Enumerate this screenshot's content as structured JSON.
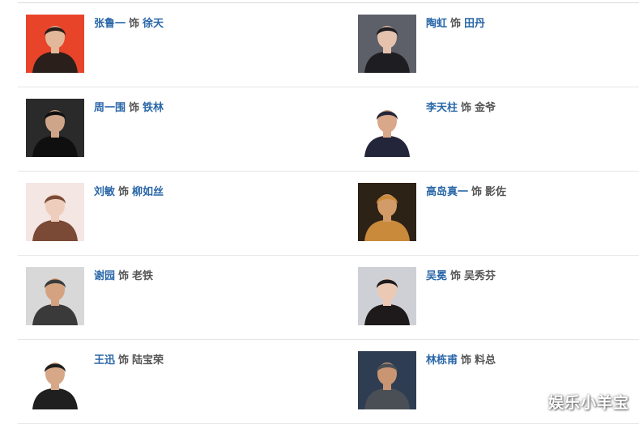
{
  "cast": [
    {
      "left": {
        "actor": "张鲁一",
        "as": "饰",
        "role": "徐天",
        "role_linked": true,
        "photo_bg": "#e8442a",
        "photo_fg": "#2a1f1a",
        "skin": "#e2b79a"
      },
      "right": {
        "actor": "陶虹",
        "as": "饰",
        "role": "田丹",
        "role_linked": true,
        "photo_bg": "#5d6068",
        "photo_fg": "#1e1d22",
        "skin": "#e4c2ad"
      }
    },
    {
      "left": {
        "actor": "周一围",
        "as": "饰",
        "role": "铁林",
        "role_linked": true,
        "photo_bg": "#2a2a2a",
        "photo_fg": "#0f0f0f",
        "skin": "#cfa58a"
      },
      "right": {
        "actor": "李天柱",
        "as": "饰",
        "role": "金爷",
        "role_linked": false,
        "photo_bg": "#ffffff",
        "photo_fg": "#23253a",
        "skin": "#d9a789"
      }
    },
    {
      "left": {
        "actor": "刘敏",
        "as": "饰",
        "role": "柳如丝",
        "role_linked": true,
        "photo_bg": "#f4e6e2",
        "photo_fg": "#7a4a36",
        "skin": "#efcdbd"
      },
      "right": {
        "actor": "高岛真一",
        "as": "饰",
        "role": "影佐",
        "role_linked": false,
        "photo_bg": "#2c2216",
        "photo_fg": "#c98a3b",
        "skin": "#d39b68"
      }
    },
    {
      "left": {
        "actor": "谢园",
        "as": "饰",
        "role": "老铁",
        "role_linked": false,
        "photo_bg": "#d8d8d8",
        "photo_fg": "#3a3a3a",
        "skin": "#d5a27f"
      },
      "right": {
        "actor": "吴冕",
        "as": "饰",
        "role": "吴秀芬",
        "role_linked": false,
        "photo_bg": "#cfd0d6",
        "photo_fg": "#1e1a1c",
        "skin": "#ecc9b4"
      }
    },
    {
      "left": {
        "actor": "王迅",
        "as": "饰",
        "role": "陆宝荣",
        "role_linked": false,
        "photo_bg": "#ffffff",
        "photo_fg": "#1f1f1f",
        "skin": "#d7a887"
      },
      "right": {
        "actor": "林栋甫",
        "as": "饰",
        "role": "料总",
        "role_linked": false,
        "photo_bg": "#2f3d52",
        "photo_fg": "#4a4f55",
        "skin": "#c99573"
      }
    }
  ],
  "watermark": "娱乐小羊宝",
  "colors": {
    "link": "#2a67a8",
    "text": "#555555",
    "divider": "#e6e6e6"
  }
}
